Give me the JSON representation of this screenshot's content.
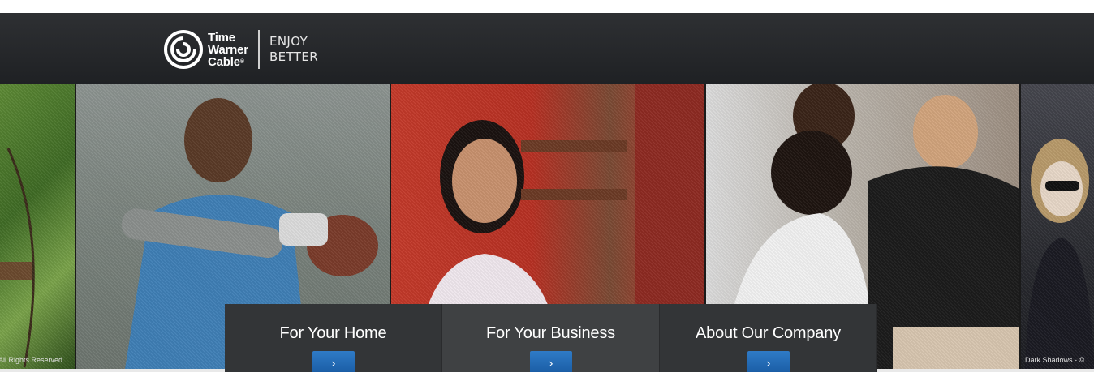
{
  "header": {
    "logo_lines": [
      "Time",
      "Warner",
      "Cable"
    ],
    "logo_reg": "®",
    "tagline_line1": "ENJOY",
    "tagline_line2": "BETTER"
  },
  "photos": [
    {
      "caption": "All Rights Reserved"
    },
    {
      "caption": ""
    },
    {
      "caption": ""
    },
    {
      "caption": ""
    },
    {
      "caption": "Dark Shadows - ©"
    }
  ],
  "nav": [
    {
      "label": "For Your Home",
      "arrow": "›"
    },
    {
      "label": "For Your Business",
      "arrow": "›"
    },
    {
      "label": "About Our Company",
      "arrow": "›"
    }
  ],
  "colors": {
    "header_bg": "#2a2c2f",
    "nav_bg": "#333537",
    "button_blue": "#1f65b0"
  }
}
